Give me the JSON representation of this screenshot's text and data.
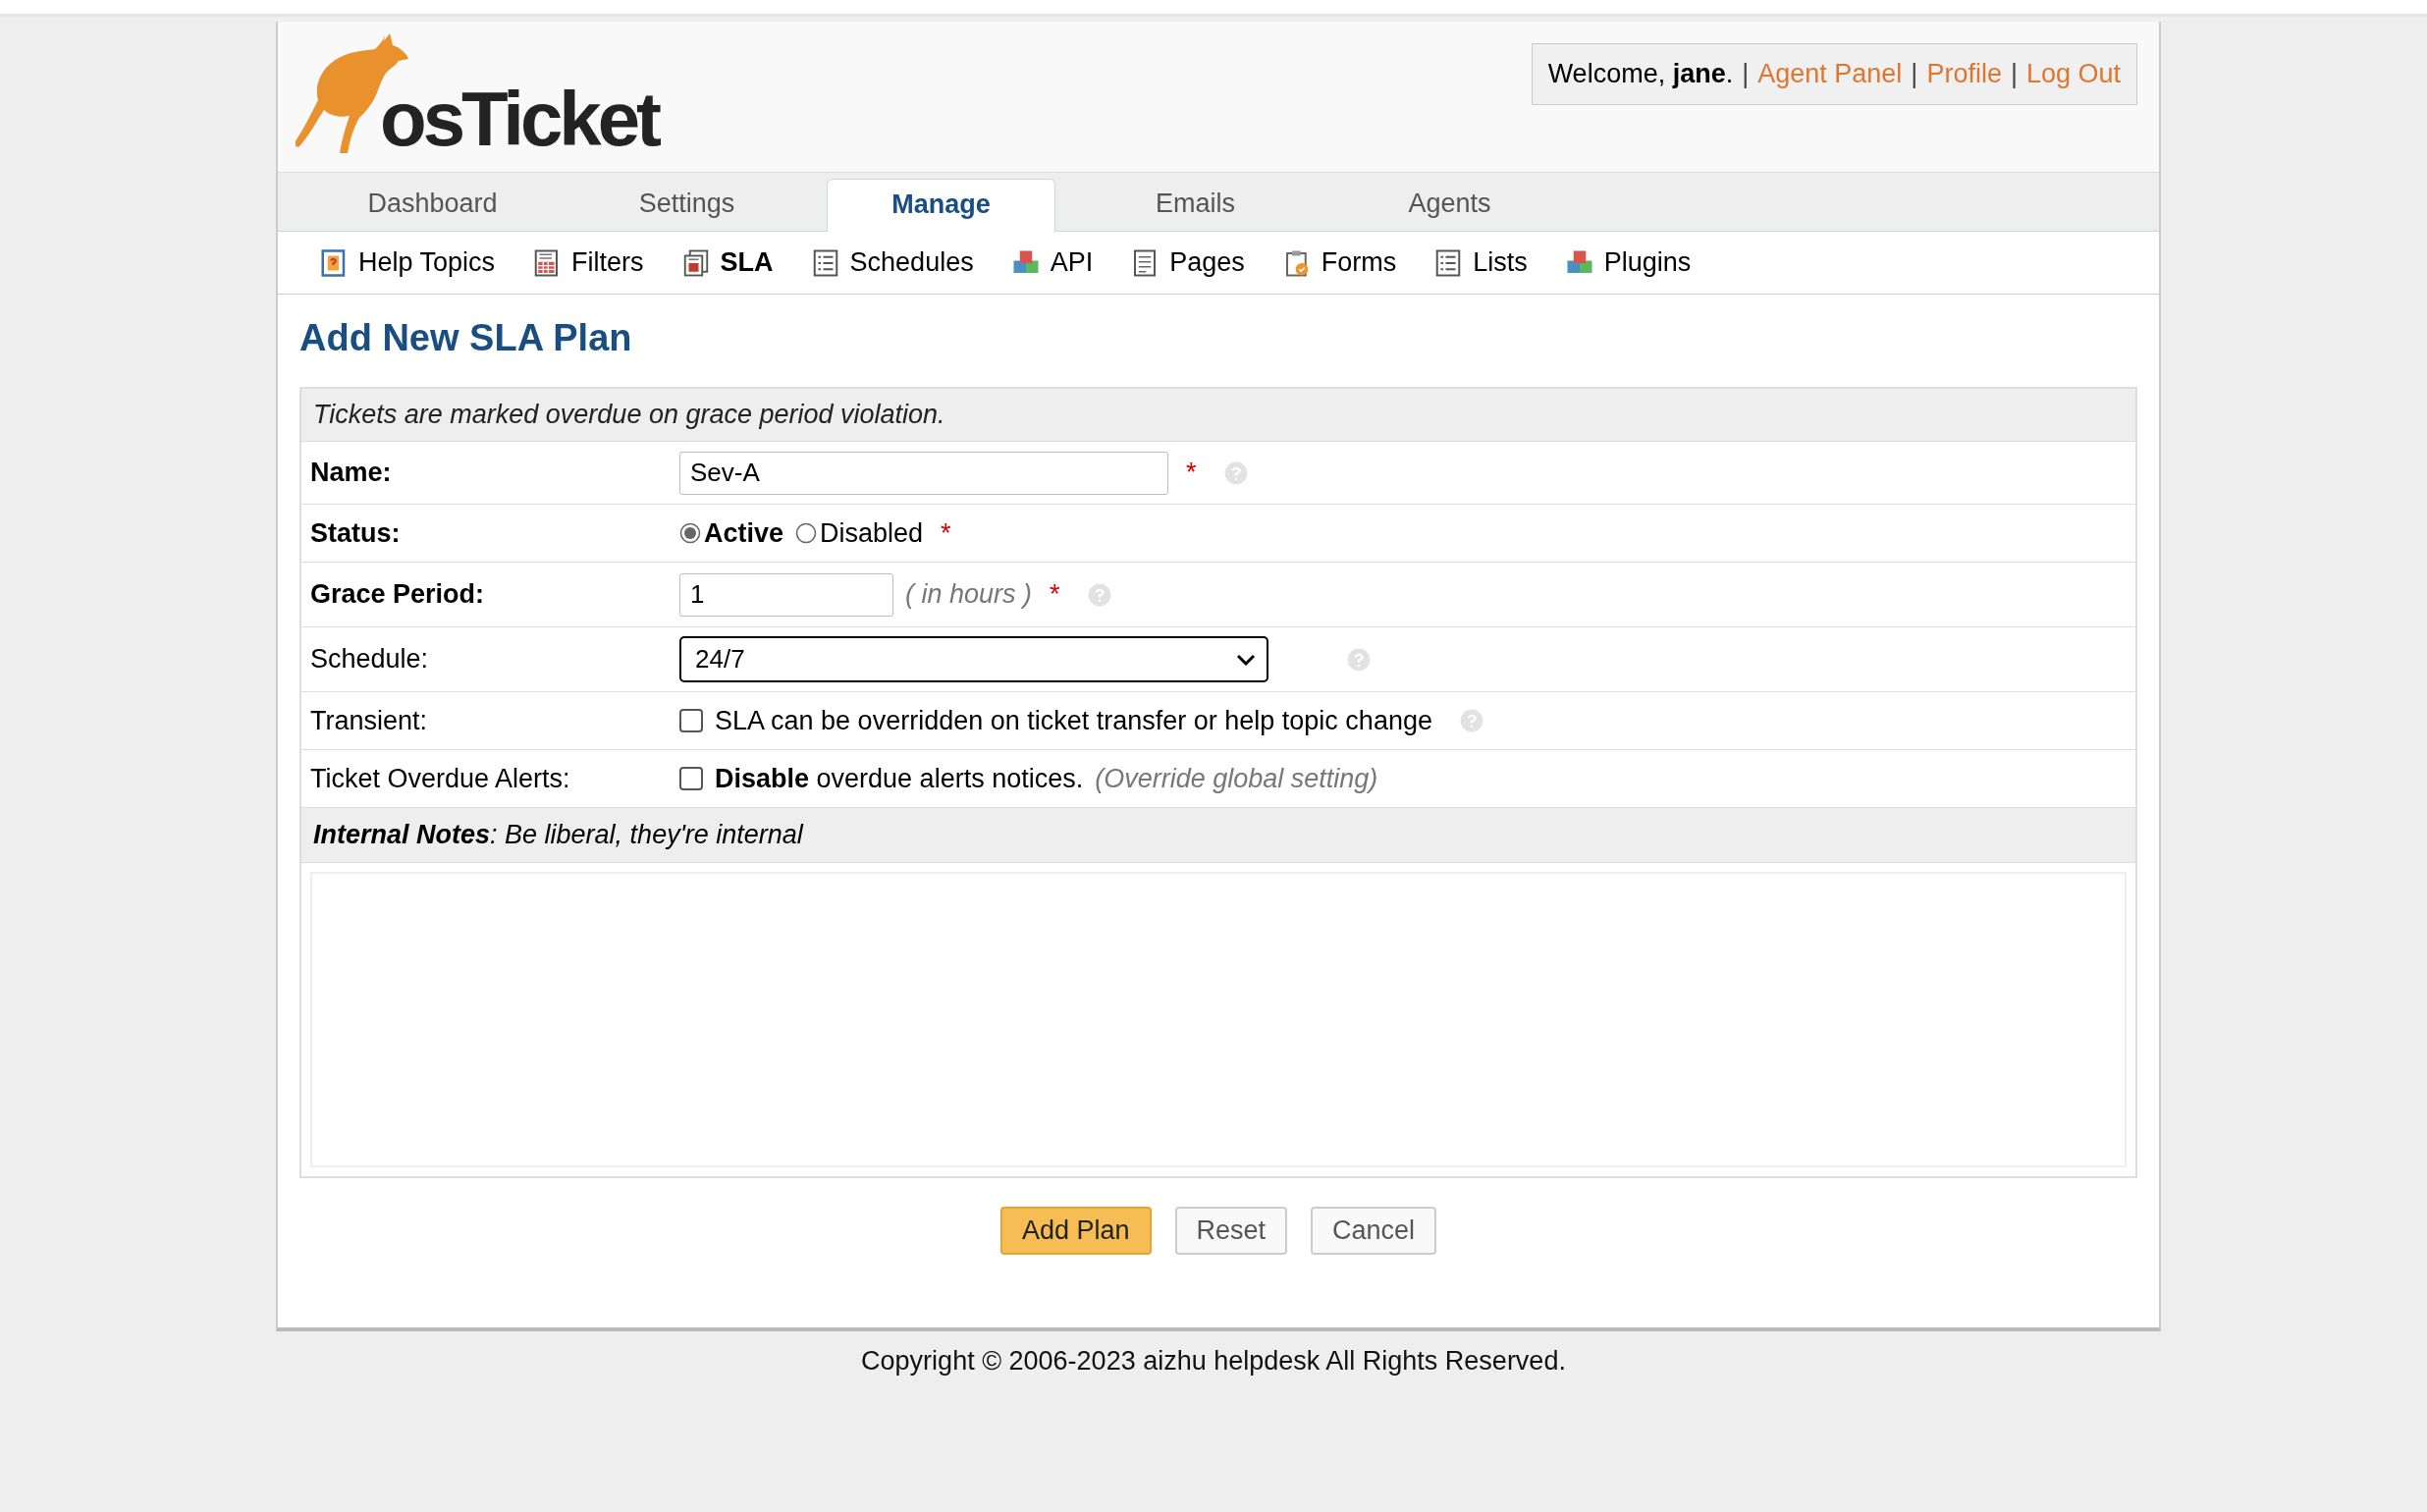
{
  "header": {
    "logo_text": "osTicket",
    "welcome": [
      {
        "kind": "text",
        "text": "Welcome, **jane**."
      },
      {
        "kind": "sep",
        "text": "|"
      },
      {
        "kind": "link",
        "text": "Agent Panel"
      },
      {
        "kind": "sep",
        "text": "|"
      },
      {
        "kind": "link",
        "text": "Profile"
      },
      {
        "kind": "sep",
        "text": "|"
      },
      {
        "kind": "link",
        "text": "Log Out"
      }
    ]
  },
  "tabs": [
    {
      "label": "Dashboard",
      "selected": false
    },
    {
      "label": "Settings",
      "selected": false
    },
    {
      "label": "Manage",
      "selected": true
    },
    {
      "label": "Emails",
      "selected": false
    },
    {
      "label": "Agents",
      "selected": false
    }
  ],
  "subnav": [
    {
      "label": "Help Topics",
      "kind": "help",
      "selected": false
    },
    {
      "label": "Filters",
      "kind": "filter",
      "selected": false
    },
    {
      "label": "SLA",
      "kind": "sla",
      "selected": true
    },
    {
      "label": "Schedules",
      "kind": "list",
      "selected": false
    },
    {
      "label": "API",
      "kind": "cubes",
      "selected": false
    },
    {
      "label": "Pages",
      "kind": "page",
      "selected": false
    },
    {
      "label": "Forms",
      "kind": "form",
      "selected": false
    },
    {
      "label": "Lists",
      "kind": "list",
      "selected": false
    },
    {
      "label": "Plugins",
      "kind": "cubes",
      "selected": false
    }
  ],
  "title": "Add New SLA Plan",
  "form": {
    "notice": "Tickets are marked overdue on grace period violation.",
    "rows": [
      {
        "kind": "text",
        "label": "Name:",
        "value": "Sev-A",
        "required_mark": "*",
        "help": true
      },
      {
        "kind": "radio",
        "label": "Status:",
        "options": [
          {
            "label": "Active",
            "selected": true
          },
          {
            "label": "Disabled",
            "selected": false
          }
        ],
        "required_mark": "*"
      },
      {
        "kind": "number",
        "label": "Grace Period:",
        "value": "1",
        "hint": "( in hours )",
        "required_mark": "*",
        "help": true
      },
      {
        "kind": "select",
        "label": "Schedule:",
        "value": "24/7",
        "help": true
      },
      {
        "kind": "checkbox",
        "label": "Transient:",
        "checked": false,
        "text": "SLA can be overridden on ticket transfer or help topic change",
        "help": true
      },
      {
        "kind": "checkbox",
        "label": "Ticket Overdue Alerts:",
        "checked": false,
        "text": "**Disable** overdue alerts notices.",
        "note": "(Override global setting)"
      }
    ],
    "notes_header": "**Internal Notes**: Be liberal, they're internal"
  },
  "buttons": [
    {
      "label": "Add Plan",
      "kind": "primary"
    },
    {
      "label": "Reset",
      "kind": "default"
    },
    {
      "label": "Cancel",
      "kind": "default"
    }
  ],
  "footer": "Copyright © 2006-2023 aizhu helpdesk All Rights Reserved."
}
